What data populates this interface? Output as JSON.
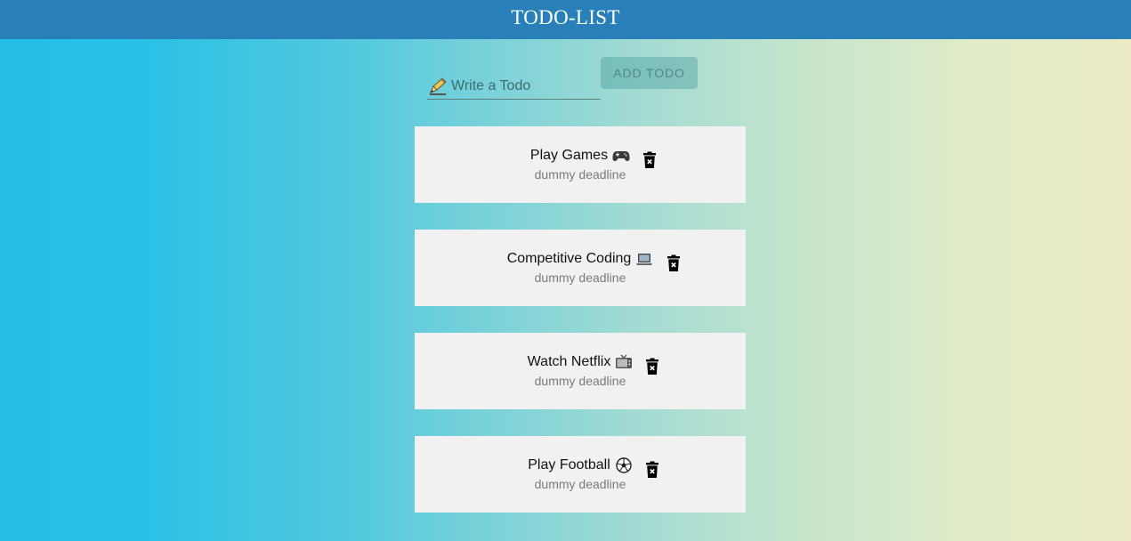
{
  "header": {
    "title": "TODO-LIST",
    "bg_color": "#2980b9"
  },
  "input": {
    "placeholder": "Write a Todo",
    "value": "",
    "icon": "pencil-icon"
  },
  "add_button": {
    "label": "ADD TODO",
    "disabled": true
  },
  "todos": [
    {
      "title": "Play Games",
      "deadline": "dummy deadline",
      "icon": "game-controller-icon"
    },
    {
      "title": "Competitive Coding",
      "deadline": "dummy deadline",
      "icon": "laptop-icon"
    },
    {
      "title": "Watch Netflix",
      "deadline": "dummy deadline",
      "icon": "television-icon"
    },
    {
      "title": "Play Football",
      "deadline": "dummy deadline",
      "icon": "soccer-ball-icon"
    }
  ]
}
